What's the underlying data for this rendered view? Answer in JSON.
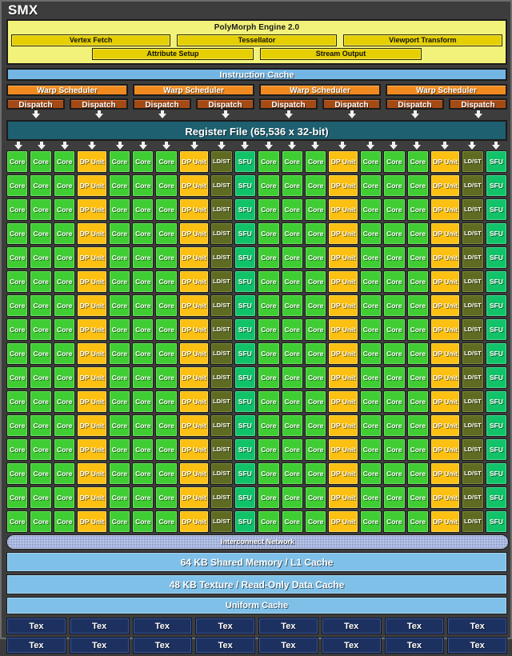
{
  "title": "SMX",
  "polymorph": {
    "title": "PolyMorph Engine 2.0",
    "row1": [
      "Vertex Fetch",
      "Tessellator",
      "Viewport Transform"
    ],
    "row2": [
      "Attribute Setup",
      "Stream Output"
    ]
  },
  "instruction_cache": "Instruction Cache",
  "warp_schedulers": [
    "Warp Scheduler",
    "Warp Scheduler",
    "Warp Scheduler",
    "Warp Scheduler"
  ],
  "dispatch_units": [
    "Dispatch",
    "Dispatch",
    "Dispatch",
    "Dispatch",
    "Dispatch",
    "Dispatch",
    "Dispatch",
    "Dispatch"
  ],
  "register_file": "Register File (65,536 x 32-bit)",
  "core_grid": {
    "rows": 16,
    "columns": 20,
    "column_pattern": [
      "Core",
      "Core",
      "Core",
      "DP Unit",
      "Core",
      "Core",
      "Core",
      "DP Unit",
      "LD/ST",
      "SFU",
      "Core",
      "Core",
      "Core",
      "DP Unit",
      "Core",
      "Core",
      "Core",
      "DP Unit",
      "LD/ST",
      "SFU"
    ],
    "labels": {
      "core": "Core",
      "dp": "DP Unit",
      "ldst": "LD/ST",
      "sfu": "SFU"
    },
    "colors": {
      "core": "#3fcd33",
      "dp": "#fbc011",
      "ldst": "#5f6b23",
      "sfu": "#12c269"
    },
    "counts": {
      "core": 192,
      "dp": 64,
      "ldst": 32,
      "sfu": 32
    }
  },
  "interconnect": "Interconnect Network",
  "caches": [
    "64 KB Shared Memory / L1 Cache",
    "48 KB Texture / Read-Only Data Cache",
    "Uniform Cache"
  ],
  "tex": {
    "label": "Tex",
    "rows": 2,
    "per_row": 8
  },
  "colors": {
    "background": "#3d3d3d",
    "polymorph": "#f2f27a",
    "polymorph_box": "#e5cf00",
    "instruction_cache": "#74b6e3",
    "warp": "#f08a1e",
    "dispatch": "#a44a15",
    "register_file": "#1e5f70",
    "interconnect": "#6d86c6",
    "cache": "#7fc0e8",
    "tex": "#1d3160"
  }
}
